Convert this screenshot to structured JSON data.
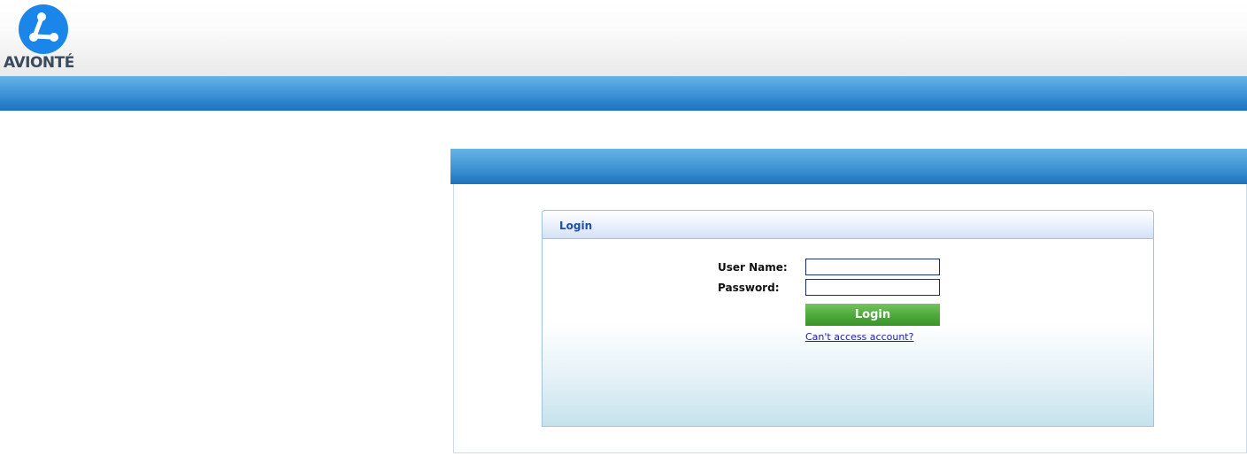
{
  "brand": {
    "name": "AVIONTÉ",
    "logo_icon": "avionte-logo-icon",
    "logo_color": "#1a86ea",
    "text_color": "#3b4a5c"
  },
  "login": {
    "title": "Login",
    "username_label": "User Name:",
    "username_value": "",
    "password_label": "Password:",
    "password_value": "",
    "submit_label": "Login",
    "help_link": "Can't access account?"
  },
  "colors": {
    "band_blue": "#3b91d6",
    "login_green": "#4fab3c",
    "link_blue": "#1a1ab5",
    "header_title_blue": "#1e4fa8"
  }
}
